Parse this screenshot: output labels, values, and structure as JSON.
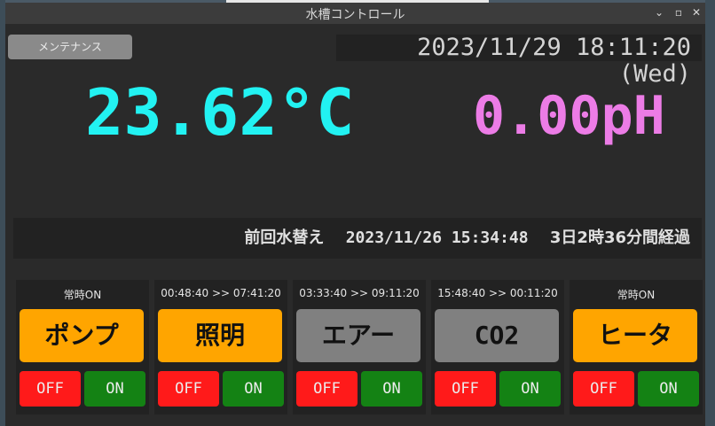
{
  "window": {
    "title": "水槽コントロール",
    "controls": [
      "⌄",
      "▫",
      "✕"
    ]
  },
  "maintenance": {
    "label": "メンテナンス"
  },
  "clock": {
    "text": "2023/11/29 18:11:20 (Wed)"
  },
  "readings": {
    "temperature": "23.62°C",
    "ph": "0.00pH",
    "temp_color": "#22f2f2",
    "ph_color": "#ec7ce6"
  },
  "water_change": {
    "label": "前回水替え",
    "datetime": "2023/11/26 15:34:48",
    "elapsed": "3日2時36分間経過"
  },
  "devices": [
    {
      "status": "常時ON",
      "name": "ポンプ",
      "color": "#ffa500",
      "off": "OFF",
      "on": "ON"
    },
    {
      "status": "00:48:40 >> 07:41:20",
      "name": "照明",
      "color": "#ffa500",
      "off": "OFF",
      "on": "ON"
    },
    {
      "status": "03:33:40 >> 09:11:20",
      "name": "エアー",
      "color": "#808080",
      "off": "OFF",
      "on": "ON"
    },
    {
      "status": "15:48:40 >> 00:11:20",
      "name": "CO2",
      "color": "#808080",
      "off": "OFF",
      "on": "ON"
    },
    {
      "status": "常時ON",
      "name": "ヒータ",
      "color": "#ffa500",
      "off": "OFF",
      "on": "ON"
    }
  ],
  "colors": {
    "off_button": "#ff1a1a",
    "on_button": "#148214"
  }
}
